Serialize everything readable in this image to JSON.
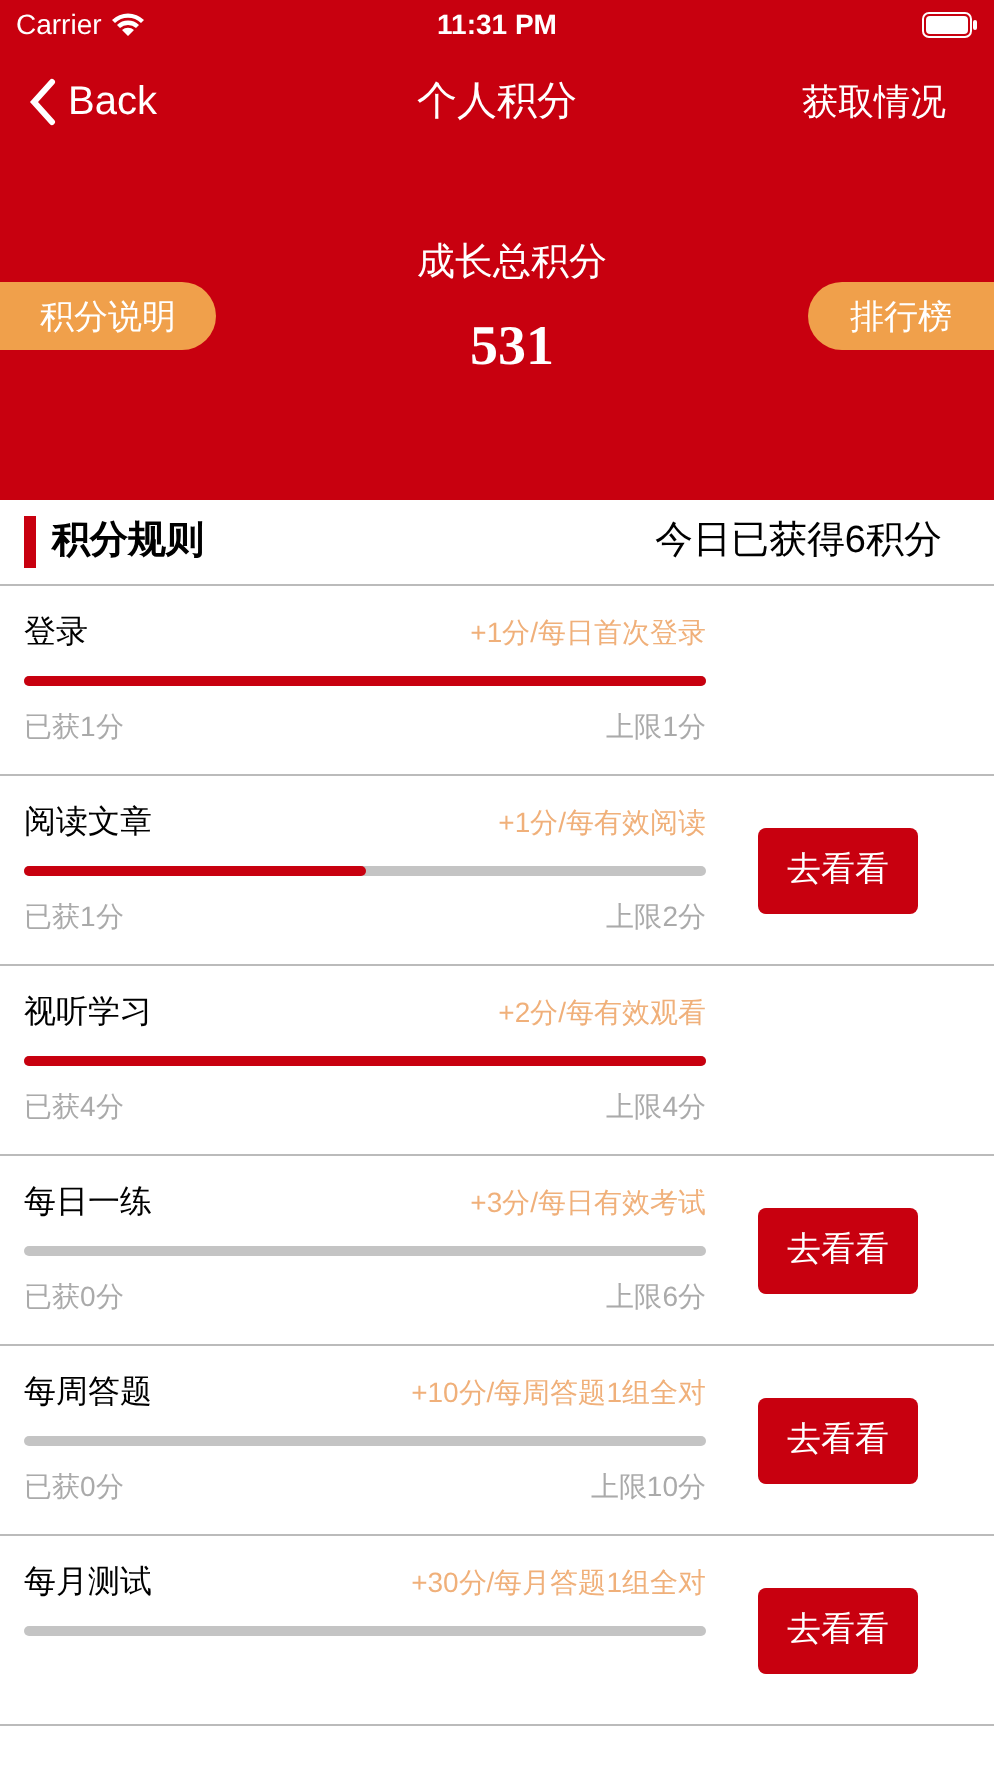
{
  "status_bar": {
    "carrier": "Carrier",
    "time": "11:31 PM"
  },
  "nav": {
    "back": "Back",
    "title": "个人积分",
    "action": "获取情况"
  },
  "summary": {
    "left_button": "积分说明",
    "label": "成长总积分",
    "total": "531",
    "right_button": "排行榜"
  },
  "rules_header": {
    "title": "积分规则",
    "today": "今日已获得6积分"
  },
  "rules": [
    {
      "name": "登录",
      "bonus": "+1分/每日首次登录",
      "level": 1,
      "earned": "已获1分",
      "limit": "上限1分"
    },
    {
      "name": "阅读文章",
      "bonus": "+1分/每有效阅读",
      "level": 0.5,
      "earned": "已获1分",
      "limit": "上限2分",
      "button": "去看看"
    },
    {
      "name": "视听学习",
      "bonus": "+2分/每有效观看",
      "level": 1,
      "earned": "已获4分",
      "limit": "上限4分"
    },
    {
      "name": "每日一练",
      "bonus": "+3分/每日有效考试",
      "level": 0,
      "earned": "已获0分",
      "limit": "上限6分",
      "button": "去看看"
    },
    {
      "name": "每周答题",
      "bonus": "+10分/每周答题1组全对",
      "level": 0,
      "earned": "已获0分",
      "limit": "上限10分",
      "button": "去看看"
    },
    {
      "name": "每月测试",
      "bonus": "+30分/每月答题1组全对",
      "level": 0,
      "button": "去看看"
    }
  ]
}
